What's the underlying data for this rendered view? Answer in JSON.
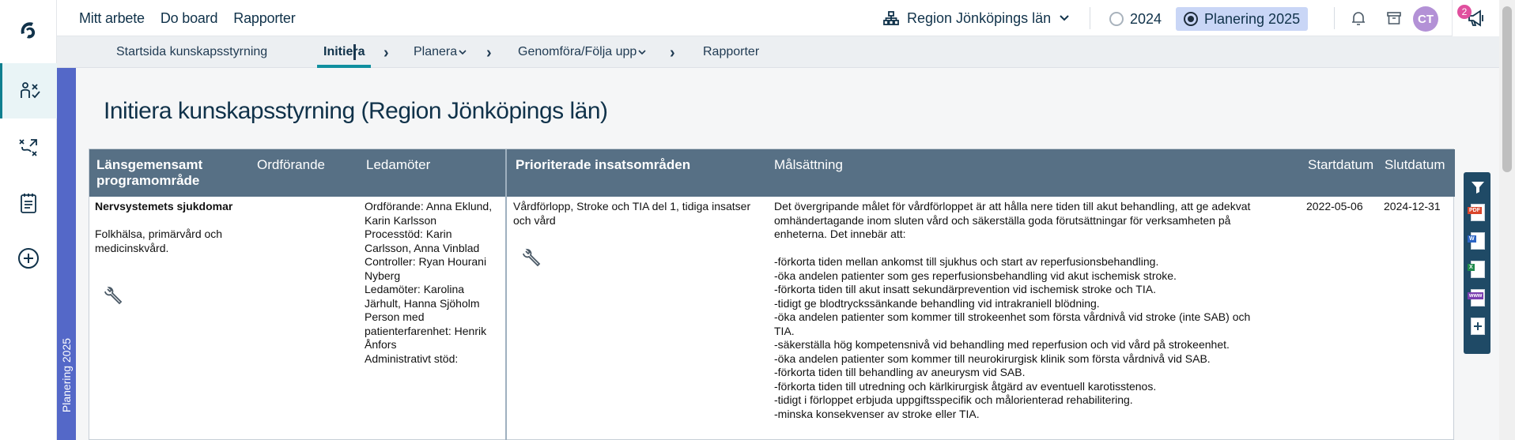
{
  "topbar": {
    "nav": [
      "Mitt arbete",
      "Do board",
      "Rapporter"
    ],
    "region": "Region Jönköpings län",
    "years": [
      {
        "label": "2024",
        "selected": false
      },
      {
        "label": "Planering 2025",
        "selected": true
      }
    ],
    "avatar": "CT",
    "notification_count": "2"
  },
  "subnav": {
    "items": [
      "Startsida kunskapsstyrning",
      "Initiera",
      "Planera",
      "Genomföra/Följa upp",
      "Rapporter"
    ],
    "active": "Initiera"
  },
  "band_label": "Planering 2025",
  "page_title": "Initiera kunskapsstyrning (Region Jönköpings län)",
  "table": {
    "headers": {
      "program_area": "Länsgemensamt programområde",
      "chair": "Ordförande",
      "members": "Ledamöter",
      "focus_areas": "Prioriterade insatsområden",
      "objective": "Målsättning",
      "start": "Startdatum",
      "end": "Slutdatum"
    },
    "row": {
      "program_area_title": "Nervsystemets sjukdomar",
      "program_area_sub": "Folkhälsa, primärvård och medicinskvård.",
      "chair": "",
      "members": [
        "Ordförande: Anna Eklund,",
        "Karin Karlsson",
        "Processtöd: Karin",
        "Carlsson, Anna Vinblad",
        "Controller: Ryan Hourani",
        "Nyberg",
        "Ledamöter: Karolina",
        "Järhult, Hanna Sjöholm",
        "Person med",
        "patienterfarenhet: Henrik",
        "Ånfors",
        "Administrativt stöd:"
      ],
      "focus_area": [
        "Vårdförlopp, Stroke och TIA del 1, tidiga insatser",
        "och vård"
      ],
      "objective": [
        "Det övergripande målet för vårdförloppet är att hålla nere tiden till akut behandling, att ge adekvat",
        "omhändertagande inom sluten vård och säkerställa goda förutsättningar för verksamheten på",
        "enheterna. Det innebär att:",
        "",
        "-förkorta tiden mellan ankomst till sjukhus och start av reperfusionsbehandling.",
        "-öka andelen patienter som ges reperfusionsbehandling vid akut ischemisk stroke.",
        "-förkorta tiden till akut insatt sekundärprevention vid ischemisk stroke och TIA.",
        "-tidigt ge blodtryckssänkande behandling vid intrakraniell blödning.",
        "-öka andelen patienter som kommer till strokeenhet som första vårdnivå vid stroke (inte SAB) och",
        "TIA.",
        "-säkerställa hög kompetensnivå vid behandling med reperfusion och vid vård på strokeenhet.",
        "-öka andelen patienter som kommer till neurokirurgisk klinik som första vårdnivå vid SAB.",
        "-förkorta tiden till behandling av aneurysm vid SAB.",
        "-förkorta tiden till utredning och kärlkirurgisk åtgärd av eventuell karotisstenos.",
        "-tidigt i förloppet erbjuda uppgiftsspecifik och målorienterad rehabilitering.",
        "-minska konsekvenser av stroke eller TIA."
      ],
      "start": "2022-05-06",
      "end": "2024-12-31"
    }
  },
  "tools": {
    "pdf_tag": "PDF",
    "word_tag": "W",
    "excel_tag": "X",
    "web_tag": "www"
  },
  "colors": {
    "accent": "#0f8f9f",
    "table_header": "#577085",
    "band": "#5468c8",
    "tool_panel": "#1f4a66"
  }
}
